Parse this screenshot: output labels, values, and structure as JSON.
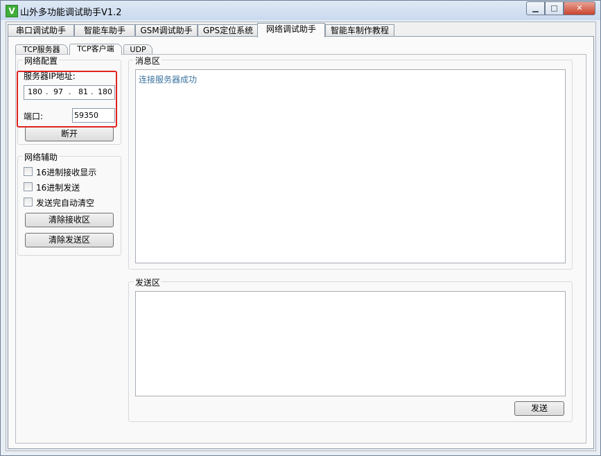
{
  "window": {
    "title": "山外多功能调试助手V1.2",
    "icon": "app-v-icon",
    "minimize": "▁",
    "maximize": "□",
    "close": "✕"
  },
  "main_tabs": [
    "串口调试助手",
    "智能车助手",
    "GSM调试助手",
    "GPS定位系统",
    "网络调试助手",
    "智能车制作教程"
  ],
  "active_main_tab": "网络调试助手",
  "sub_tabs": [
    "TCP服务器",
    "TCP客户端",
    "UDP"
  ],
  "active_sub_tab": "TCP客户端",
  "network_config": {
    "title": "网络配置",
    "server_ip_label": "服务器IP地址:",
    "ip": [
      "180",
      "97",
      "81",
      "180"
    ],
    "port_label": "端口:",
    "port_value": "59350",
    "disconnect_button": "断开"
  },
  "network_assist": {
    "title": "网络辅助",
    "options": [
      {
        "label": "16进制接收显示",
        "checked": false
      },
      {
        "label": "16进制发送",
        "checked": false
      },
      {
        "label": "发送完自动清空",
        "checked": false
      }
    ],
    "clear_receive_button": "清除接收区",
    "clear_send_button": "清除发送区"
  },
  "message_area": {
    "title": "消息区",
    "lines": [
      "连接服务器成功"
    ]
  },
  "send_area": {
    "title": "发送区",
    "value": "",
    "send_button": "发送"
  },
  "colors": {
    "highlight": "#e0231f",
    "message_text": "#3b73a0"
  }
}
